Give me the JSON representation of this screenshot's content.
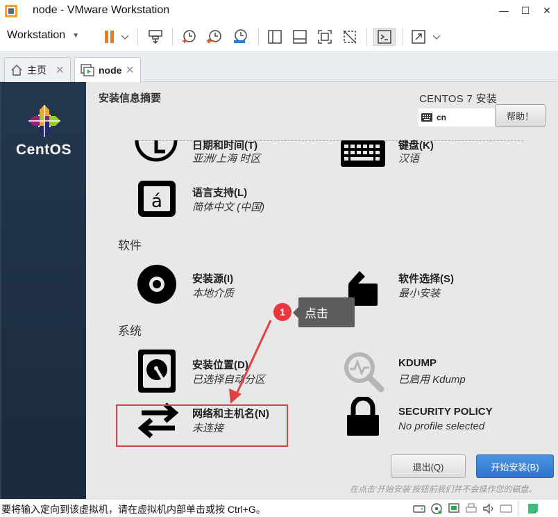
{
  "window": {
    "title": "node - VMware Workstation",
    "minimize": "—",
    "maximize": "☐",
    "close": "✕"
  },
  "toolbar": {
    "workstation_label": "Workstation",
    "icons": [
      "pause-icon",
      "send-keys-icon",
      "snapshot-icon",
      "revert-snapshot-icon",
      "manage-snapshots-icon",
      "library-view-icon",
      "thumbnail-view-icon",
      "fullscreen-icon",
      "unity-icon",
      "console-icon",
      "stretch-icon"
    ]
  },
  "tabs": [
    {
      "label": "主页",
      "icon": "home-icon",
      "active": false
    },
    {
      "label": "node",
      "icon": "vm-icon",
      "active": true
    }
  ],
  "sidebar": {
    "brand": "CentOS"
  },
  "installer": {
    "summary_title": "安装信息摘要",
    "product_title": "CENTOS 7 安装",
    "keyboard_layout": "cn",
    "help_button": "帮助！",
    "categories": {
      "software": "软件",
      "system": "系统"
    },
    "spokes": {
      "datetime": {
        "title": "日期和时间(T)",
        "status": "亚洲/上海 时区",
        "icon": "clock-icon"
      },
      "keyboard": {
        "title": "键盘(K)",
        "status": "汉语",
        "icon": "keyboard-icon"
      },
      "language": {
        "title": "语言支持(L)",
        "status": "简体中文 (中国)",
        "icon": "language-icon"
      },
      "source": {
        "title": "安装源(I)",
        "status": "本地介质",
        "icon": "disc-icon"
      },
      "software": {
        "title": "软件选择(S)",
        "status": "最小安装",
        "icon": "package-icon"
      },
      "destination": {
        "title": "安装位置(D)",
        "status": "已选择自动分区",
        "icon": "harddisk-icon"
      },
      "kdump": {
        "title": "KDUMP",
        "status": "已启用 Kdump",
        "icon": "kdump-search-icon"
      },
      "network": {
        "title": "网络和主机名(N)",
        "status": "未连接",
        "icon": "network-arrows-icon"
      },
      "security": {
        "title": "SECURITY POLICY",
        "status": "No profile selected",
        "icon": "lock-icon"
      }
    },
    "quit_button": "退出(Q)",
    "begin_button": "开始安装(B)",
    "footnote": "在点击‘开始安装’按钮前我们并不会操作您的磁盘。"
  },
  "annotation": {
    "badge_number": "1",
    "tooltip_text": "点击",
    "color": "#e04141"
  },
  "statusbar": {
    "message": "要将输入定向到该虚拟机，请在虚拟机内部单击或按 Ctrl+G。"
  },
  "colors": {
    "sidebar": "#1f3047",
    "begin_button": "#3a7fd6",
    "main_bg": "#e8e8e8"
  }
}
